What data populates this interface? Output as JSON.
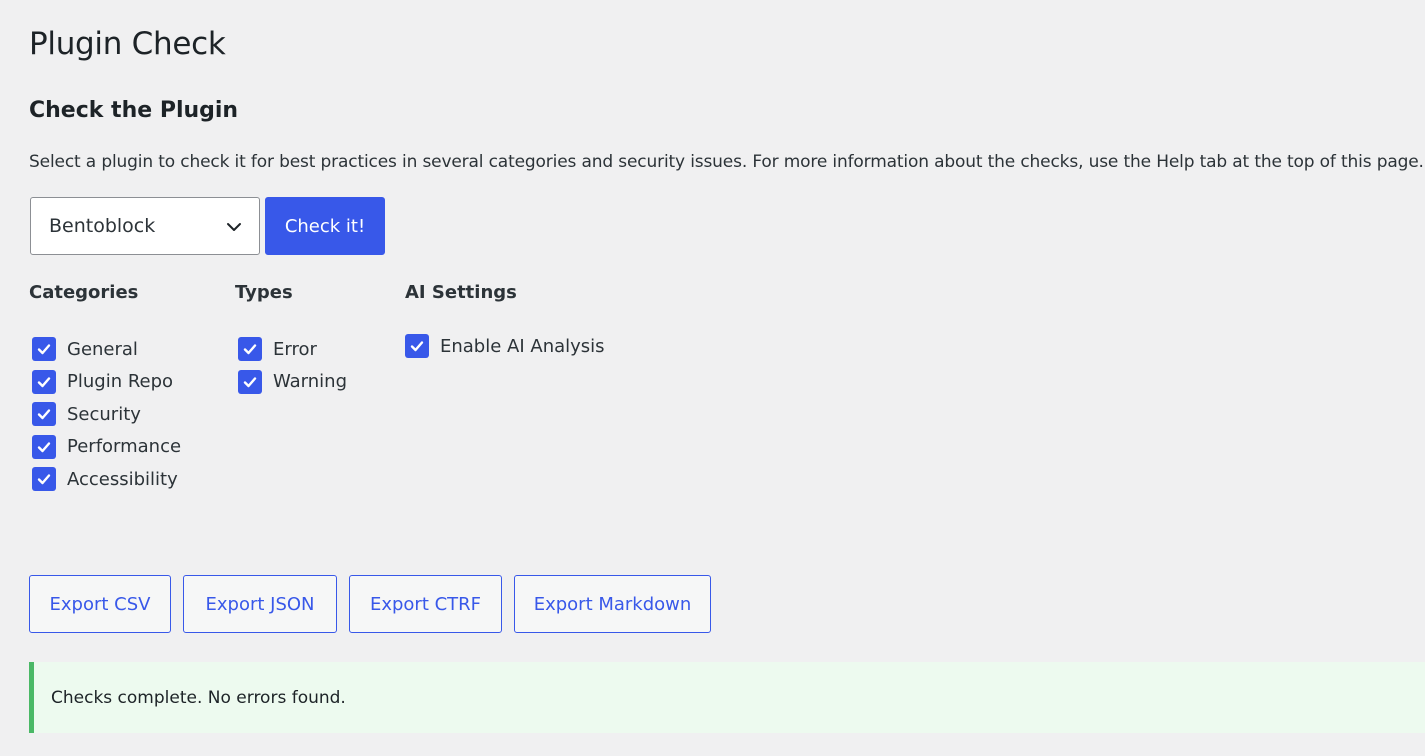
{
  "page": {
    "title": "Plugin Check"
  },
  "section": {
    "title": "Check the Plugin",
    "description": "Select a plugin to check it for best practices in several categories and security issues. For more information about the checks, use the Help tab at the top of this page."
  },
  "plugin_select": {
    "selected": "Bentoblock",
    "icon": "chevron-down-icon"
  },
  "check_button": {
    "label": "Check it!"
  },
  "categories": {
    "title": "Categories",
    "items": [
      {
        "label": "General",
        "checked": true
      },
      {
        "label": "Plugin Repo",
        "checked": true
      },
      {
        "label": "Security",
        "checked": true
      },
      {
        "label": "Performance",
        "checked": true
      },
      {
        "label": "Accessibility",
        "checked": true
      }
    ]
  },
  "types": {
    "title": "Types",
    "items": [
      {
        "label": "Error",
        "checked": true
      },
      {
        "label": "Warning",
        "checked": true
      }
    ]
  },
  "ai_settings": {
    "title": "AI Settings",
    "items": [
      {
        "label": "Enable AI Analysis",
        "checked": true
      }
    ]
  },
  "exports": {
    "csv": "Export CSV",
    "json": "Export JSON",
    "ctrf": "Export CTRF",
    "markdown": "Export Markdown"
  },
  "notice": {
    "text": "Checks complete. No errors found."
  },
  "colors": {
    "accent": "#3858e9",
    "background": "#f0f0f1",
    "notice_bg": "#edfaef",
    "notice_border": "#4ab866"
  }
}
